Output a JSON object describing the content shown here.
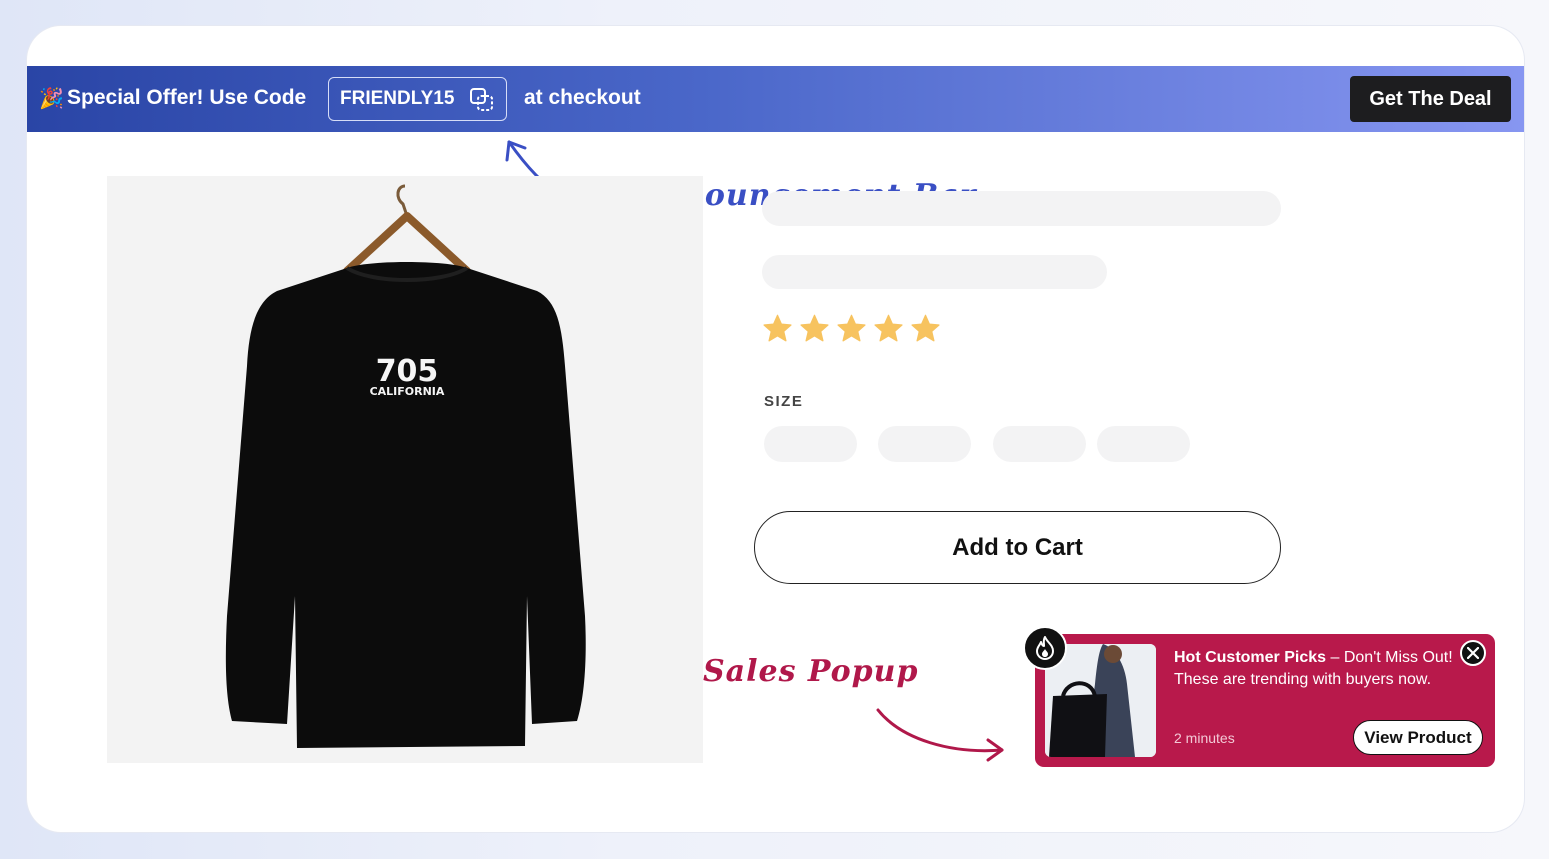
{
  "announcement_bar": {
    "emoji": "🎉",
    "offer_text": "Special Offer! Use Code",
    "code": "FRIENDLY15",
    "after_text": "at checkout",
    "deal_button": "Get The Deal",
    "gradient_colors": [
      "#2a45a6",
      "#8796f1"
    ]
  },
  "annotations": {
    "announcement_label": "Announcement Bar",
    "sales_popup_label": "Sales Popup",
    "announcement_color": "#3a4fc4",
    "sales_color": "#b0184a"
  },
  "product": {
    "image_print_number": "705",
    "image_print_text": "CALIFORNIA",
    "rating_stars": 5,
    "star_color": "#f7c35f",
    "size_label": "SIZE",
    "add_to_cart": "Add to Cart"
  },
  "sales_popup": {
    "headline_bold": "Hot Customer Picks",
    "headline_rest": " – Don't Miss Out! These are trending with buyers now.",
    "time": "2 minutes",
    "view_button": "View Product",
    "background_color": "#b8194b"
  }
}
